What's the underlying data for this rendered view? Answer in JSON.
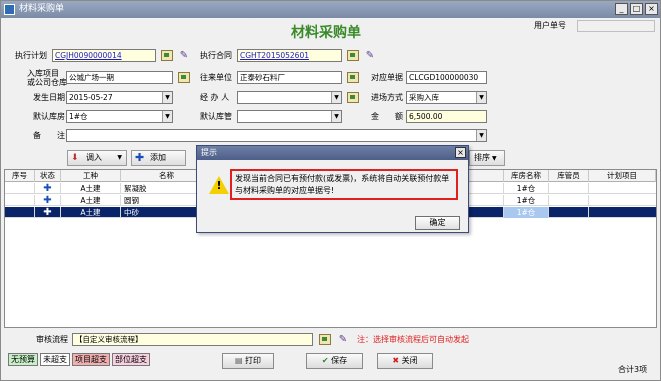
{
  "window": {
    "title": "材料采购单",
    "controls": [
      "_",
      "□",
      "×"
    ]
  },
  "form": {
    "title": "材料采购单",
    "user_order_label": "用户单号",
    "user_order_value": ""
  },
  "fields": {
    "plan_label": "执行计划",
    "plan_value": "CGJH0090000014",
    "contract_label": "执行合同",
    "contract_value": "CGHT2015052601",
    "project_label_1": "入库项目",
    "project_label_2": "或公司仓库",
    "project_value": "公城广场一期",
    "partner_label": "往来单位",
    "partner_value": "正泰砂石料厂",
    "doc_label": "对应单据",
    "doc_value": "CLCGD100000030",
    "date_label": "发生日期",
    "date_value": "2015-05-27",
    "handler_label": "经 办 人",
    "handler_value": "",
    "mode_label": "进场方式",
    "mode_value": "采购入库",
    "warehouse_label": "默认库房",
    "warehouse_value": "1#仓",
    "keeper_label": "默认库管",
    "keeper_value": "",
    "amount_label": "金　　额",
    "amount_value": "6,500.00",
    "remark_label": "备　　注",
    "remark_value": ""
  },
  "toolbar": {
    "import_label": "调入",
    "add_label": "添加",
    "sort_label": "排序"
  },
  "grid": {
    "headers": [
      "序号",
      "状态",
      "工种",
      "名称",
      "",
      "库房名称",
      "库管员",
      "计划项目"
    ],
    "rows": [
      {
        "no": "",
        "type": "A土建",
        "name": "絮凝胶",
        "warehouse": "1#仓"
      },
      {
        "no": "",
        "type": "A土建",
        "name": "圆钢",
        "warehouse": "1#仓"
      },
      {
        "no": "",
        "type": "A土建",
        "name": "中砂",
        "warehouse": "1#仓"
      }
    ]
  },
  "dialog": {
    "title": "提示",
    "message": "发现当前合同已有预付款(或发票)，系统将自动关联预付款单与材料采购单的对应单据号!",
    "ok_label": "确定"
  },
  "review": {
    "label": "审核流程",
    "value": "【自定义审核流程】",
    "note": "注：选择审核流程后可自动发起"
  },
  "legend": [
    {
      "label": "无预算",
      "color": "#c8f0c8"
    },
    {
      "label": "未超支",
      "color": "#ffffff"
    },
    {
      "label": "项目超支",
      "color": "#f0b0b0"
    },
    {
      "label": "部位超支",
      "color": "#f8d0e0"
    }
  ],
  "footer": {
    "print_label": "打印",
    "save_label": "保存",
    "close_label": "关闭",
    "total_label": "合计3项"
  },
  "colors": {
    "title_green": "#3a8a2a",
    "selected_row": "#0a246a",
    "warning_red": "#e02020"
  }
}
